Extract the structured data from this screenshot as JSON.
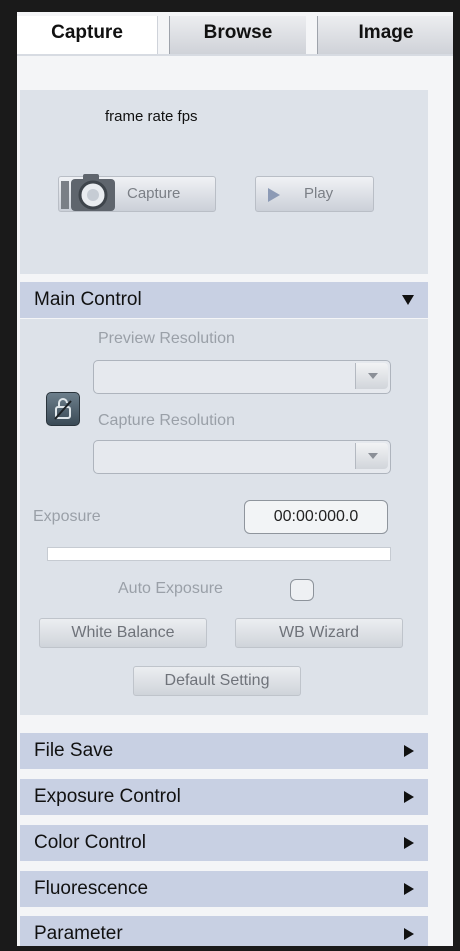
{
  "tabs": [
    {
      "label": "Capture",
      "active": true
    },
    {
      "label": "Browse",
      "active": false
    },
    {
      "label": "Image",
      "active": false
    }
  ],
  "top_panel": {
    "fps_label": "frame rate fps",
    "capture_button": "Capture",
    "play_button": "Play"
  },
  "main_control": {
    "title": "Main Control",
    "expanded": true,
    "preview_resolution_label": "Preview Resolution",
    "preview_resolution_value": "",
    "capture_resolution_label": "Capture Resolution",
    "capture_resolution_value": "",
    "exposure_label": "Exposure",
    "exposure_value": "00:00:000.0",
    "auto_exposure_label": "Auto Exposure",
    "white_balance_button": "White Balance",
    "wb_wizard_button": "WB Wizard",
    "default_setting_button": "Default Setting"
  },
  "sections": [
    {
      "title": "File Save",
      "expanded": false
    },
    {
      "title": "Exposure Control",
      "expanded": false
    },
    {
      "title": "Color Control",
      "expanded": false
    },
    {
      "title": "Fluorescence",
      "expanded": false
    },
    {
      "title": "Parameter",
      "expanded": false
    }
  ],
  "colors": {
    "section_header": "#c8d0e3",
    "panel_bg": "#dde2e9",
    "frame": "#1a1a1a"
  }
}
